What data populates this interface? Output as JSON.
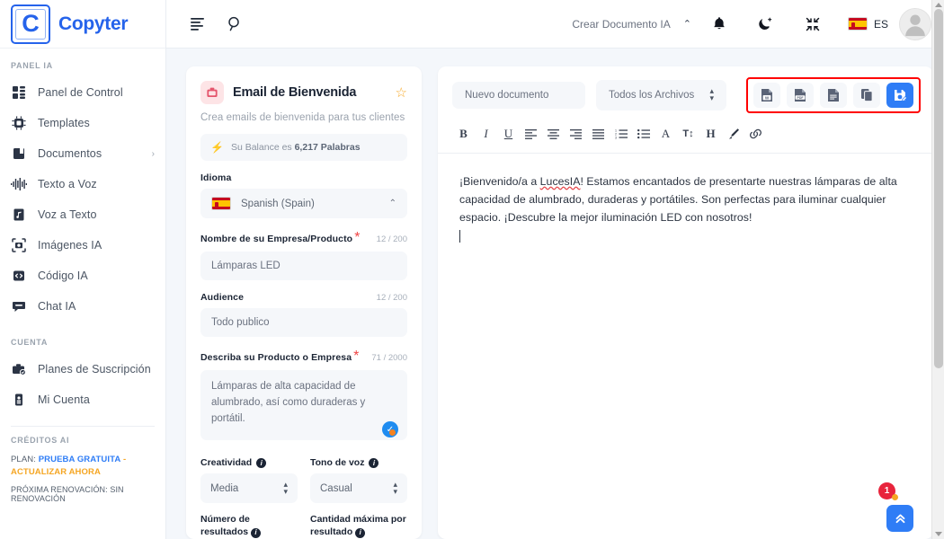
{
  "brand": {
    "letter": "C",
    "name": "Copyter"
  },
  "sidebar": {
    "section_panel": "PANEL IA",
    "items": [
      {
        "label": "Panel de Control",
        "icon": "dashboard-icon"
      },
      {
        "label": "Templates",
        "icon": "chip-icon"
      },
      {
        "label": "Documentos",
        "icon": "book-icon",
        "caret": "›"
      },
      {
        "label": "Texto a Voz",
        "icon": "waveform-icon"
      },
      {
        "label": "Voz a Texto",
        "icon": "audio-file-icon"
      },
      {
        "label": "Imágenes IA",
        "icon": "camera-icon"
      },
      {
        "label": "Código IA",
        "icon": "code-icon"
      },
      {
        "label": "Chat IA",
        "icon": "chat-icon"
      }
    ],
    "section_account": "CUENTA",
    "account_items": [
      {
        "label": "Planes de Suscripción",
        "icon": "briefcase-check-icon"
      },
      {
        "label": "Mi Cuenta",
        "icon": "id-card-icon"
      }
    ],
    "section_credits": "CRÉDITOS AI",
    "plan_prefix": "PLAN:",
    "plan_value": "PRUEBA GRATUITA",
    "plan_dash": "-",
    "plan_upgrade": "ACTUALIZAR AHORA",
    "renewal": "PRÓXIMA RENOVACIÓN: SIN RENOVACIÓN"
  },
  "topbar": {
    "menu_icon": "menu-align-left-icon",
    "search_icon": "search-icon",
    "create_doc_label": "Crear Documento IA",
    "caret": "⌃",
    "bell_icon": "bell-icon",
    "theme_icon": "moon-icon",
    "fullscreen_icon": "collapse-icon",
    "lang_code": "ES"
  },
  "form": {
    "badge_icon": "briefcase-icon",
    "title": "Email de Bienvenida",
    "star_icon": "star-icon",
    "subtitle": "Crea emails de bienvenida para tus clientes",
    "balance_prefix": "Su Balance es",
    "balance_value": "6,217 Palabras",
    "language_label": "Idioma",
    "language_value": "Spanish (Spain)",
    "fields": [
      {
        "label": "Nombre de su Empresa/Producto",
        "required": true,
        "count": "12 / 200",
        "value": "Lámparas LED"
      },
      {
        "label": "Audience",
        "required": false,
        "count": "12 / 200",
        "value": "Todo publico"
      }
    ],
    "desc_label": "Describa su Producto o Empresa",
    "desc_count": "71 / 2000",
    "desc_value": "Lámparas de alta capacidad de alumbrado, así como duraderas y portátil.",
    "creativity_label": "Creatividad",
    "creativity_value": "Media",
    "tone_label": "Tono de voz",
    "tone_value": "Casual",
    "results_label": "Número de resultados",
    "maxlen_label": "Cantidad máxima por resultado"
  },
  "editor": {
    "new_doc_label": "Nuevo documento",
    "filter_label": "Todos los Archivos",
    "actions": [
      {
        "name": "export-word-button",
        "icon": "word-file-icon",
        "label": "W"
      },
      {
        "name": "export-pdf-button",
        "icon": "pdf-file-icon",
        "label": "PDF"
      },
      {
        "name": "export-text-button",
        "icon": "text-file-icon",
        "label": ""
      },
      {
        "name": "copy-button",
        "icon": "copy-icon",
        "label": ""
      },
      {
        "name": "save-button",
        "icon": "save-document-icon",
        "label": ""
      }
    ],
    "format_tools": [
      {
        "name": "bold-button",
        "glyph": "B"
      },
      {
        "name": "italic-button",
        "glyph": "I"
      },
      {
        "name": "underline-button",
        "glyph": "U"
      },
      {
        "name": "align-left-button",
        "glyph": "align-left-icon"
      },
      {
        "name": "align-center-button",
        "glyph": "align-center-icon"
      },
      {
        "name": "align-right-button",
        "glyph": "align-right-icon"
      },
      {
        "name": "align-justify-button",
        "glyph": "align-justify-icon"
      },
      {
        "name": "ordered-list-button",
        "glyph": "ordered-list-icon"
      },
      {
        "name": "unordered-list-button",
        "glyph": "unordered-list-icon"
      },
      {
        "name": "font-family-button",
        "glyph": "A"
      },
      {
        "name": "font-size-button",
        "glyph": "T↕"
      },
      {
        "name": "heading-button",
        "glyph": "H"
      },
      {
        "name": "highlight-button",
        "glyph": "brush-icon"
      },
      {
        "name": "link-button",
        "glyph": "link-icon"
      }
    ],
    "document": {
      "line1_a": "¡Bienvenido/a a ",
      "line1_misspelled": "LucesIA",
      "line1_b": "! Estamos encantados de presentarte nuestras lámparas de alta capacidad de alumbrado, duraderas y portátiles. Son perfectas para iluminar cualquier espacio. ¡Descubre la mejor iluminación LED con nosotros!"
    }
  },
  "floating": {
    "notification_count": "1",
    "scroll_top_icon": "double-chevron-up-icon"
  },
  "colors": {
    "brand_blue": "#2563eb",
    "accent_blue": "#2f7df6",
    "highlight_red": "#ff0000",
    "badge_red": "#e8243c",
    "star_orange": "#f7a928"
  }
}
